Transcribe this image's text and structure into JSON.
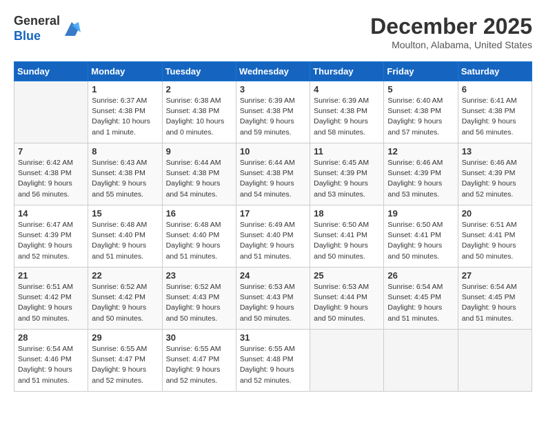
{
  "header": {
    "logo_general": "General",
    "logo_blue": "Blue",
    "month_title": "December 2025",
    "location": "Moulton, Alabama, United States"
  },
  "days_of_week": [
    "Sunday",
    "Monday",
    "Tuesday",
    "Wednesday",
    "Thursday",
    "Friday",
    "Saturday"
  ],
  "weeks": [
    [
      {
        "day": "",
        "content": ""
      },
      {
        "day": "1",
        "content": "Sunrise: 6:37 AM\nSunset: 4:38 PM\nDaylight: 10 hours\nand 1 minute."
      },
      {
        "day": "2",
        "content": "Sunrise: 6:38 AM\nSunset: 4:38 PM\nDaylight: 10 hours\nand 0 minutes."
      },
      {
        "day": "3",
        "content": "Sunrise: 6:39 AM\nSunset: 4:38 PM\nDaylight: 9 hours\nand 59 minutes."
      },
      {
        "day": "4",
        "content": "Sunrise: 6:39 AM\nSunset: 4:38 PM\nDaylight: 9 hours\nand 58 minutes."
      },
      {
        "day": "5",
        "content": "Sunrise: 6:40 AM\nSunset: 4:38 PM\nDaylight: 9 hours\nand 57 minutes."
      },
      {
        "day": "6",
        "content": "Sunrise: 6:41 AM\nSunset: 4:38 PM\nDaylight: 9 hours\nand 56 minutes."
      }
    ],
    [
      {
        "day": "7",
        "content": "Sunrise: 6:42 AM\nSunset: 4:38 PM\nDaylight: 9 hours\nand 56 minutes."
      },
      {
        "day": "8",
        "content": "Sunrise: 6:43 AM\nSunset: 4:38 PM\nDaylight: 9 hours\nand 55 minutes."
      },
      {
        "day": "9",
        "content": "Sunrise: 6:44 AM\nSunset: 4:38 PM\nDaylight: 9 hours\nand 54 minutes."
      },
      {
        "day": "10",
        "content": "Sunrise: 6:44 AM\nSunset: 4:38 PM\nDaylight: 9 hours\nand 54 minutes."
      },
      {
        "day": "11",
        "content": "Sunrise: 6:45 AM\nSunset: 4:39 PM\nDaylight: 9 hours\nand 53 minutes."
      },
      {
        "day": "12",
        "content": "Sunrise: 6:46 AM\nSunset: 4:39 PM\nDaylight: 9 hours\nand 53 minutes."
      },
      {
        "day": "13",
        "content": "Sunrise: 6:46 AM\nSunset: 4:39 PM\nDaylight: 9 hours\nand 52 minutes."
      }
    ],
    [
      {
        "day": "14",
        "content": "Sunrise: 6:47 AM\nSunset: 4:39 PM\nDaylight: 9 hours\nand 52 minutes."
      },
      {
        "day": "15",
        "content": "Sunrise: 6:48 AM\nSunset: 4:40 PM\nDaylight: 9 hours\nand 51 minutes."
      },
      {
        "day": "16",
        "content": "Sunrise: 6:48 AM\nSunset: 4:40 PM\nDaylight: 9 hours\nand 51 minutes."
      },
      {
        "day": "17",
        "content": "Sunrise: 6:49 AM\nSunset: 4:40 PM\nDaylight: 9 hours\nand 51 minutes."
      },
      {
        "day": "18",
        "content": "Sunrise: 6:50 AM\nSunset: 4:41 PM\nDaylight: 9 hours\nand 50 minutes."
      },
      {
        "day": "19",
        "content": "Sunrise: 6:50 AM\nSunset: 4:41 PM\nDaylight: 9 hours\nand 50 minutes."
      },
      {
        "day": "20",
        "content": "Sunrise: 6:51 AM\nSunset: 4:41 PM\nDaylight: 9 hours\nand 50 minutes."
      }
    ],
    [
      {
        "day": "21",
        "content": "Sunrise: 6:51 AM\nSunset: 4:42 PM\nDaylight: 9 hours\nand 50 minutes."
      },
      {
        "day": "22",
        "content": "Sunrise: 6:52 AM\nSunset: 4:42 PM\nDaylight: 9 hours\nand 50 minutes."
      },
      {
        "day": "23",
        "content": "Sunrise: 6:52 AM\nSunset: 4:43 PM\nDaylight: 9 hours\nand 50 minutes."
      },
      {
        "day": "24",
        "content": "Sunrise: 6:53 AM\nSunset: 4:43 PM\nDaylight: 9 hours\nand 50 minutes."
      },
      {
        "day": "25",
        "content": "Sunrise: 6:53 AM\nSunset: 4:44 PM\nDaylight: 9 hours\nand 50 minutes."
      },
      {
        "day": "26",
        "content": "Sunrise: 6:54 AM\nSunset: 4:45 PM\nDaylight: 9 hours\nand 51 minutes."
      },
      {
        "day": "27",
        "content": "Sunrise: 6:54 AM\nSunset: 4:45 PM\nDaylight: 9 hours\nand 51 minutes."
      }
    ],
    [
      {
        "day": "28",
        "content": "Sunrise: 6:54 AM\nSunset: 4:46 PM\nDaylight: 9 hours\nand 51 minutes."
      },
      {
        "day": "29",
        "content": "Sunrise: 6:55 AM\nSunset: 4:47 PM\nDaylight: 9 hours\nand 52 minutes."
      },
      {
        "day": "30",
        "content": "Sunrise: 6:55 AM\nSunset: 4:47 PM\nDaylight: 9 hours\nand 52 minutes."
      },
      {
        "day": "31",
        "content": "Sunrise: 6:55 AM\nSunset: 4:48 PM\nDaylight: 9 hours\nand 52 minutes."
      },
      {
        "day": "",
        "content": ""
      },
      {
        "day": "",
        "content": ""
      },
      {
        "day": "",
        "content": ""
      }
    ]
  ]
}
